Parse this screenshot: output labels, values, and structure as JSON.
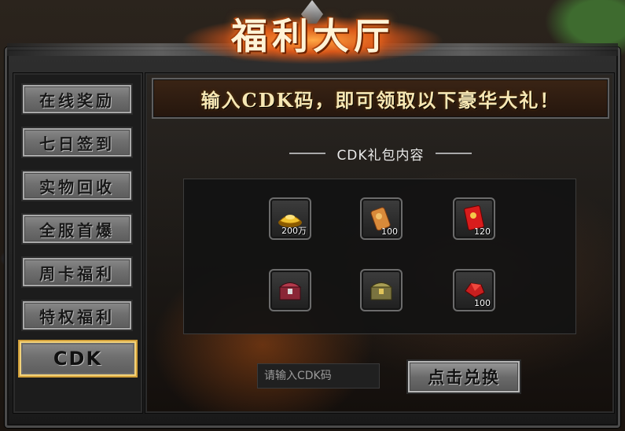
{
  "window": {
    "title": "福利大厅"
  },
  "sidebar": {
    "items": [
      {
        "label": "在线奖励"
      },
      {
        "label": "七日签到"
      },
      {
        "label": "实物回收"
      },
      {
        "label": "全服首爆"
      },
      {
        "label": "周卡福利"
      },
      {
        "label": "特权福利"
      },
      {
        "label": "CDK",
        "active": true
      }
    ]
  },
  "main": {
    "banner": "输入CDK码，即可领取以下豪华大礼！",
    "section_title": "CDK礼包内容",
    "gifts": [
      {
        "icon": "gold-ingot-icon",
        "qty": "200万"
      },
      {
        "icon": "scroll-icon",
        "qty": "100"
      },
      {
        "icon": "red-envelope-icon",
        "qty": "120"
      },
      {
        "icon": "red-treasure-chest-icon",
        "qty": ""
      },
      {
        "icon": "gold-treasure-chest-icon",
        "qty": ""
      },
      {
        "icon": "red-gem-icon",
        "qty": "100"
      }
    ],
    "input_placeholder": "请输入CDK码",
    "redeem_label": "点击兑换"
  },
  "colors": {
    "accent_gold": "#d3a13a",
    "title_glow": "#ff7a20"
  }
}
